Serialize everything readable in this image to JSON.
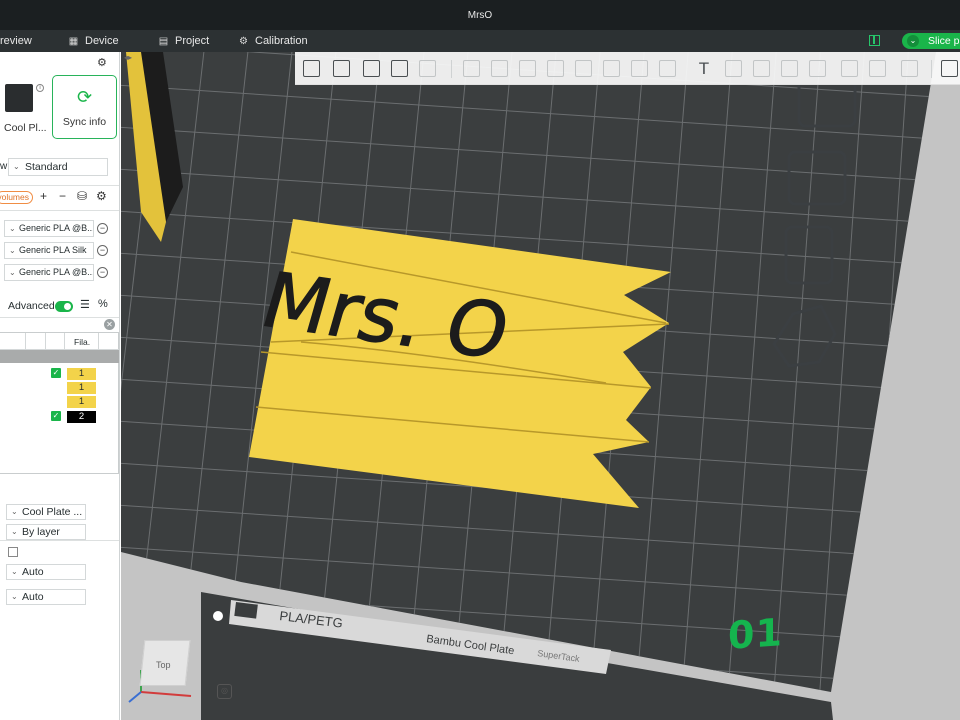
{
  "window": {
    "title": "MrsO"
  },
  "nav": {
    "preview": "review",
    "device": "Device",
    "project": "Project",
    "calibration": "Calibration",
    "slice": "Slice pl"
  },
  "left_panel": {
    "plate_label": "Cool Pl...",
    "sync_label": "Sync info",
    "w_label": "w",
    "process_preset": "Standard",
    "volumes_badge": "volumes",
    "filaments": [
      "Generic PLA @B...",
      "Generic PLA Silk",
      "Generic PLA @B..."
    ],
    "advanced_label": "Advanced",
    "advanced_on": true,
    "object_table": {
      "col_filament": "Fila.",
      "rows": [
        {
          "checked": true,
          "filament": "1",
          "color": "#f3d34a"
        },
        {
          "checked": false,
          "filament": "1",
          "color": "#f3d34a"
        },
        {
          "checked": false,
          "filament": "1",
          "color": "#f3d34a"
        },
        {
          "checked": true,
          "filament": "2",
          "color": "#000000"
        }
      ]
    },
    "settings": {
      "plate_type": "Cool Plate ...",
      "sequence": "By layer",
      "mode_a": "Auto",
      "mode_b": "Auto"
    }
  },
  "viewport": {
    "model_text": "Mrs. O",
    "bed_label_material": "PLA/PETG",
    "bed_label_plate": "Bambu Cool Plate",
    "bed_label_sub": "SuperTack",
    "plate_number": "01",
    "view_cube_label": "Top"
  },
  "colors": {
    "accent": "#1ab54a",
    "model_yellow": "#f3d34a",
    "bed": "#3c3f40",
    "grid": "#6e7173"
  }
}
